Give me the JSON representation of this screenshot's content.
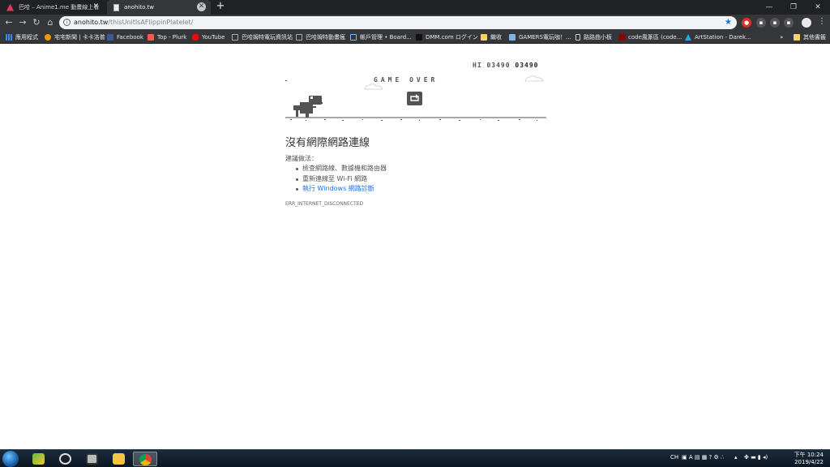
{
  "browser": {
    "tabs": [
      {
        "title": "巴哈 – Anime1.me 動畫線上看",
        "active": false
      },
      {
        "title": "anohito.tw",
        "active": true
      }
    ],
    "new_tab": "+",
    "window_controls": {
      "minimize": "—",
      "maximize": "❐",
      "close": "✕"
    },
    "address": {
      "host": "anohito.tw",
      "path": "/thisUnitIsAFlippinPlatelet/"
    },
    "bookmarks": [
      {
        "label": "應用程式",
        "icon": "apps-grid-icon"
      },
      {
        "label": "宅宅新聞 | 卡卡洛普",
        "icon": "gamme-icon"
      },
      {
        "label": "Facebook",
        "icon": "facebook-icon"
      },
      {
        "label": "Top - Plurk",
        "icon": "plurk-icon"
      },
      {
        "label": "YouTube",
        "icon": "youtube-icon"
      },
      {
        "label": "巴哈姆特電玩資訊站",
        "icon": "bahamut-icon"
      },
      {
        "label": "巴哈姆特動畫瘋",
        "icon": "bahamut-icon"
      },
      {
        "label": "帳戶管理 • Board...",
        "icon": "board-icon"
      },
      {
        "label": "DMM.com ログイン",
        "icon": "dmm-icon"
      },
      {
        "label": "繼收",
        "icon": "folder-icon"
      },
      {
        "label": "GAMERS電玩咖！...",
        "icon": "gamers-icon"
      },
      {
        "label": "路路曲小板",
        "icon": "page-icon"
      },
      {
        "label": "code風篆區 (code...",
        "icon": "code-icon"
      },
      {
        "label": "ArtStation - Darek...",
        "icon": "artstation-icon"
      }
    ],
    "bookmarks_overflow": "»",
    "other_bookmarks": "其他書籤"
  },
  "page": {
    "hi_label": "HI",
    "hi_score": "03490",
    "current_score": "03490",
    "game_over": "GAME OVER",
    "heading": "沒有網際網路連線",
    "suggest_label": "建議做法：",
    "suggestions": [
      "檢查網路線、數據機和路由器",
      "重新連線至 Wi-Fi 網路",
      "執行 Windows 網路診斷"
    ],
    "error_code": "ERR_INTERNET_DISCONNECTED"
  },
  "taskbar": {
    "tray_lang": "CH",
    "time": "下午 10:24",
    "date": "2019/4/22"
  },
  "colors": {
    "titlebar": "#202124",
    "toolbar": "#35363a",
    "link": "#1a73e8",
    "dino": "#535353"
  }
}
